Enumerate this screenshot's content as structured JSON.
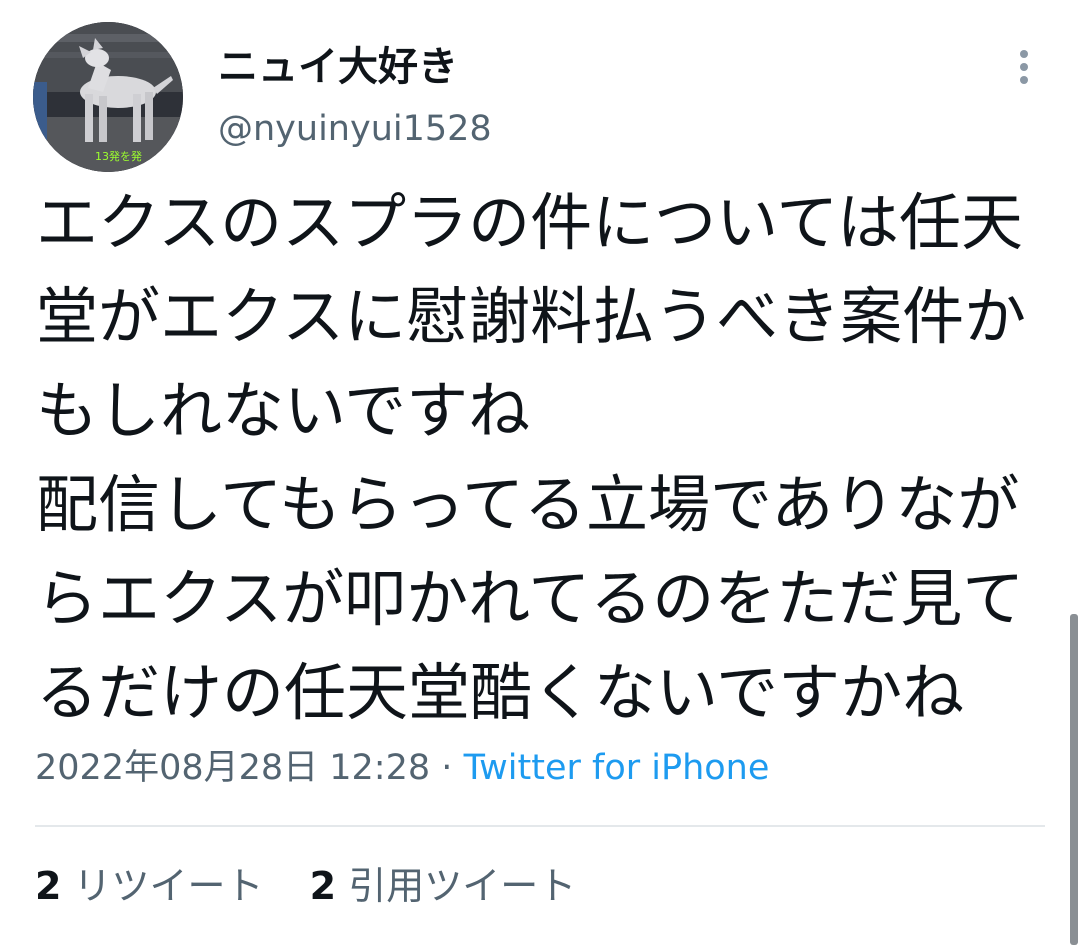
{
  "user": {
    "display_name": "ニュイ大好き",
    "handle": "@nyuinyui1528",
    "avatar_caption": "13発を発"
  },
  "tweet": {
    "lines": [
      "エクスのスプラの件については任天",
      "堂がエクスに慰謝料払うべき案件か",
      "もしれないですね",
      "配信してもらってる立場でありなが",
      "らエクスが叩かれてるのをただ見て",
      "るだけの任天堂酷くないですかね"
    ],
    "timestamp": "2022年08月28日 12:28",
    "separator": "·",
    "source": "Twitter for iPhone"
  },
  "stats": {
    "retweets": {
      "count": "2",
      "label": "リツイート"
    },
    "quotes": {
      "count": "2",
      "label": "引用ツイート"
    }
  },
  "icons": {
    "more": "more-vertical-icon"
  },
  "colors": {
    "text": "#0f1419",
    "secondary": "#536471",
    "link": "#1d9bf0",
    "divider": "#e4e8eb"
  }
}
